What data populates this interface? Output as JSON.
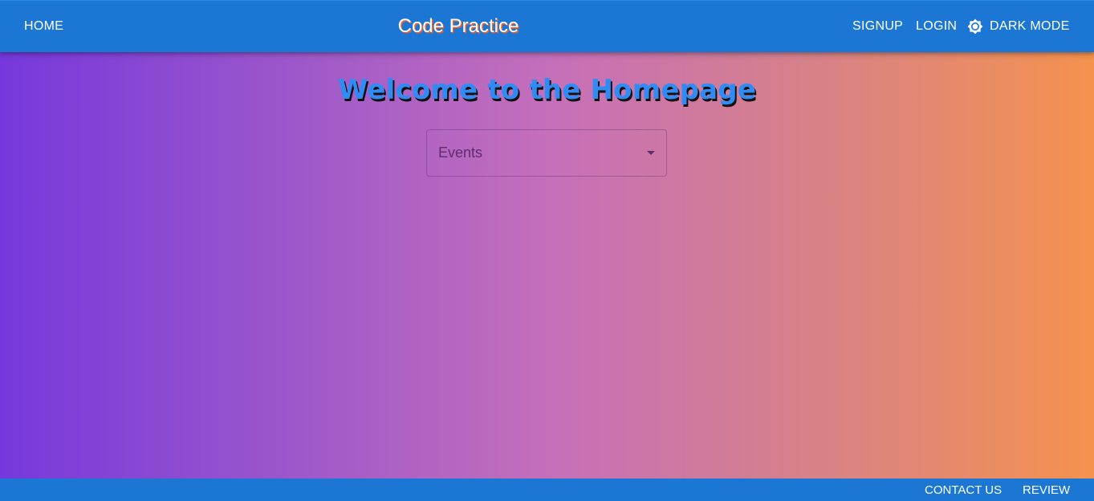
{
  "header": {
    "title": "Code Practice",
    "nav_left": {
      "home": "HOME"
    },
    "nav_right": {
      "signup": "SIGNUP",
      "login": "LOGIN",
      "dark_mode": "DARK MODE",
      "dark_mode_icon": "brightness-icon"
    }
  },
  "main": {
    "heading": "Welcome to the Homepage",
    "select": {
      "value": "Events",
      "icon": "arrow-drop-down-icon"
    }
  },
  "footer": {
    "contact": "CONTACT US",
    "review": "REVIEW"
  },
  "colors": {
    "appbar": "#1b77d3",
    "gradient_start": "#7638dc",
    "gradient_end": "#f5924e",
    "heading": "#2f8cf5",
    "title_shadow": "#f0622a"
  }
}
